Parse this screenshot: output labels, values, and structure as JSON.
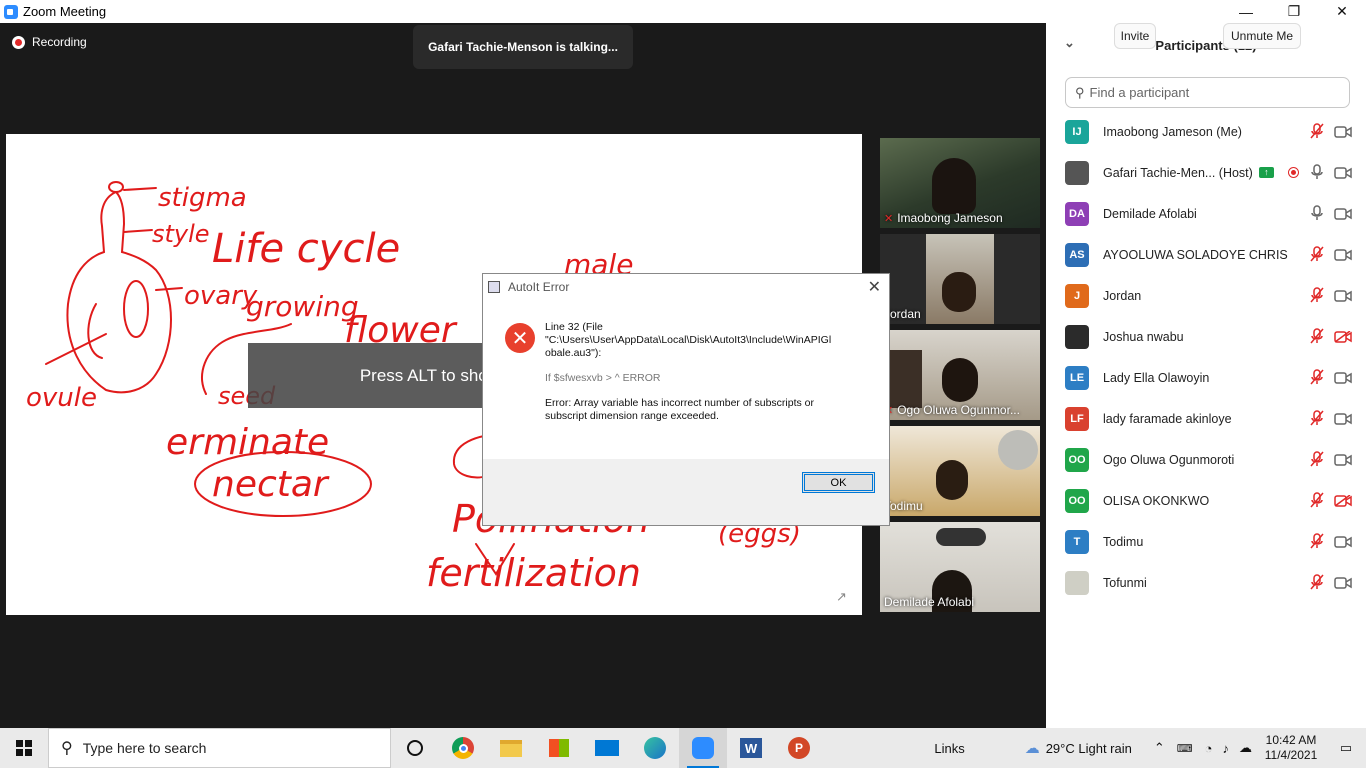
{
  "window": {
    "title": "Zoom Meeting",
    "minimize": "—",
    "maximize": "❐",
    "close": "✕"
  },
  "meeting": {
    "recording_label": "Recording",
    "talking_label": "Gafari Tachie-Menson is talking...",
    "alt_hint": "Press ALT to show or hide meeting controls"
  },
  "whiteboard": {
    "words": [
      "stigma",
      "style",
      "Life cycle",
      "male",
      "ovary",
      "growing",
      "flower",
      "ovule",
      "seed",
      "germinate",
      "nectar",
      "Pollination",
      "(eggs)",
      "fertilization"
    ]
  },
  "dialog": {
    "title": "AutoIt Error",
    "line1": "Line 32  (File",
    "line2": "\"C:\\Users\\User\\AppData\\Local\\Disk\\AutoIt3\\Include\\WinAPIGl",
    "line3": "obale.au3\"):",
    "line4": "If $sfwesxvb > ^ ERROR",
    "error1": "Error: Array variable has incorrect number of subscripts or",
    "error2": "subscript dimension range exceeded.",
    "ok": "OK"
  },
  "tiles": [
    {
      "name": "Imaobong Jameson",
      "muted": true
    },
    {
      "name": "Jordan",
      "muted": false
    },
    {
      "name": "Ogo Oluwa Ogunmor...",
      "muted": true
    },
    {
      "name": "Todimu",
      "muted": false
    },
    {
      "name": "Demilade Afolabi",
      "muted": false
    }
  ],
  "participants": {
    "header": "Participants (12)",
    "search_placeholder": "Find a participant",
    "list": [
      {
        "initials": "IJ",
        "name": "Imaobong Jameson (Me)",
        "color": "#1aa59a",
        "mic": "muted",
        "cam": "off"
      },
      {
        "initials": "",
        "name": "Gafari Tachie-Men... (Host)",
        "color": "#555555",
        "mic": "on",
        "cam": "off"
      },
      {
        "initials": "DA",
        "name": "Demilade Afolabi",
        "color": "#8e3fb5",
        "mic": "on",
        "cam": "off"
      },
      {
        "initials": "AS",
        "name": "AYOOLUWA SOLADOYE CHRIS",
        "color": "#2d6eb5",
        "mic": "muted",
        "cam": "off"
      },
      {
        "initials": "J",
        "name": "Jordan",
        "color": "#e06a1b",
        "mic": "muted",
        "cam": "off"
      },
      {
        "initials": "",
        "name": "Joshua nwabu",
        "color": "#2b2b2b",
        "mic": "muted",
        "cam": "muted"
      },
      {
        "initials": "LE",
        "name": "Lady Ella Olawoyin",
        "color": "#2d7ec4",
        "mic": "muted",
        "cam": "off"
      },
      {
        "initials": "LF",
        "name": "lady faramade akinloye",
        "color": "#d9412f",
        "mic": "muted",
        "cam": "off"
      },
      {
        "initials": "OO",
        "name": "Ogo Oluwa Ogunmoroti",
        "color": "#20a64a",
        "mic": "muted",
        "cam": "off"
      },
      {
        "initials": "OO",
        "name": "OLISA OKONKWO",
        "color": "#20a64a",
        "mic": "muted",
        "cam": "muted"
      },
      {
        "initials": "T",
        "name": "Todimu",
        "color": "#2d7ec4",
        "mic": "muted",
        "cam": "off"
      },
      {
        "initials": "",
        "name": "Tofunmi",
        "color": "#cfcfc5",
        "mic": "muted",
        "cam": "off"
      }
    ],
    "invite": "Invite",
    "unmute": "Unmute Me"
  },
  "taskbar": {
    "search_placeholder": "Type here to search",
    "links": "Links",
    "weather": "29°C  Light rain",
    "time": "10:42 AM",
    "date": "11/4/2021"
  }
}
